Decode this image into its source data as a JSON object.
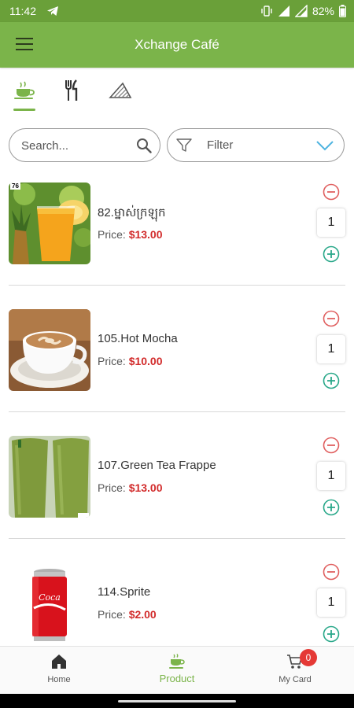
{
  "status_bar": {
    "time": "11:42",
    "battery": "82%"
  },
  "app_bar": {
    "title": "Xchange Café"
  },
  "category_tabs": [
    {
      "icon": "coffee-cup-icon",
      "active": true
    },
    {
      "icon": "fork-knife-icon",
      "active": false
    },
    {
      "icon": "pastry-icon",
      "active": false
    }
  ],
  "search": {
    "placeholder": "Search...",
    "value": ""
  },
  "filter": {
    "label": "Filter"
  },
  "products": [
    {
      "name": "82.ម្នាស់ក្រឡុក",
      "price_label": "Price:",
      "price": "$13.00",
      "qty": "1",
      "badge": "76",
      "image": "pineapple-juice"
    },
    {
      "name": "105.Hot Mocha",
      "price_label": "Price:",
      "price": "$10.00",
      "qty": "1",
      "image": "hot-mocha"
    },
    {
      "name": "107.Green Tea Frappe",
      "price_label": "Price:",
      "price": "$13.00",
      "qty": "1",
      "image": "green-tea-frappe"
    },
    {
      "name": "114.Sprite",
      "price_label": "Price:",
      "price": "$2.00",
      "qty": "1",
      "image": "soda-can"
    }
  ],
  "bottom_nav": {
    "home": "Home",
    "product": "Product",
    "cart": "My Card",
    "cart_count": "0"
  },
  "colors": {
    "primary": "#7bb44a",
    "status_bar": "#6aa039",
    "price": "#d22c2c",
    "minus": "#e06060",
    "plus": "#2aa88a",
    "badge": "#e53935"
  }
}
